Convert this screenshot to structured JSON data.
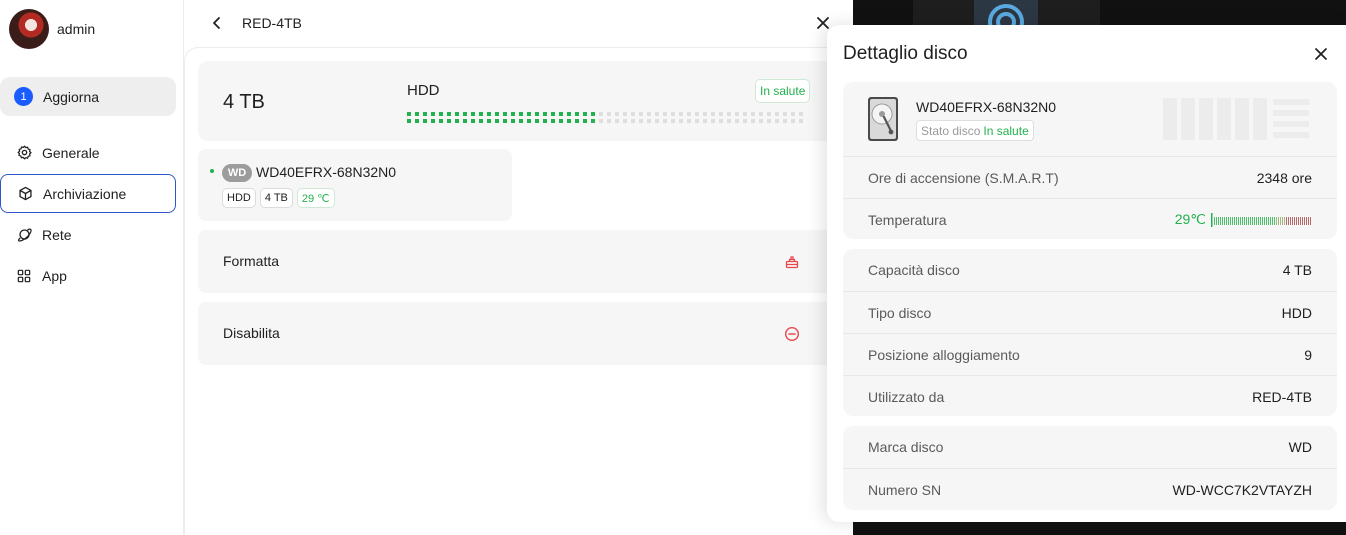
{
  "sidebar": {
    "user_name": "admin",
    "update": {
      "count": "1",
      "label": "Aggiorna"
    },
    "items": [
      {
        "label": "Generale",
        "icon": "gear-icon"
      },
      {
        "label": "Archiviazione",
        "icon": "cube-icon"
      },
      {
        "label": "Rete",
        "icon": "planet-icon"
      },
      {
        "label": "App",
        "icon": "grid-icon"
      }
    ],
    "active_item": "Archiviazione"
  },
  "header": {
    "title": "RED-4TB"
  },
  "summary": {
    "capacity": "4 TB",
    "type": "HDD",
    "health": "In salute",
    "usage_fraction": 0.47
  },
  "disk_card": {
    "brand_logo": "WD",
    "model": "WD40EFRX-68N32N0",
    "tags": {
      "type": "HDD",
      "capacity": "4 TB",
      "temperature": "29 ℃"
    }
  },
  "actions": {
    "format": {
      "label": "Formatta",
      "icon": "eraser-icon"
    },
    "disable": {
      "label": "Disabilita",
      "icon": "minus-circle-icon"
    }
  },
  "drawer": {
    "title": "Dettaglio disco",
    "model": "WD40EFRX-68N32N0",
    "status_label": "Stato disco",
    "status_value": "In salute",
    "power_on": {
      "label": "Ore di accensione (S.M.A.R.T)",
      "value": "2348 ore"
    },
    "temperature": {
      "label": "Temperatura",
      "value": "29℃",
      "level": 0.62
    },
    "capacity": {
      "label": "Capacità disco",
      "value": "4 TB"
    },
    "disk_type": {
      "label": "Tipo disco",
      "value": "HDD"
    },
    "bay": {
      "label": "Posizione alloggiamento",
      "value": "9"
    },
    "used_by": {
      "label": "Utilizzato da",
      "value": "RED-4TB"
    },
    "brand": {
      "label": "Marca disco",
      "value": "WD"
    },
    "serial": {
      "label": "Numero SN",
      "value": "WD-WCC7K2VTAYZH"
    }
  },
  "colors": {
    "accent_blue": "#1a5cff",
    "healthy_green": "#22b14c",
    "danger_red": "#e5484d",
    "dark_backdrop": "#111111"
  }
}
